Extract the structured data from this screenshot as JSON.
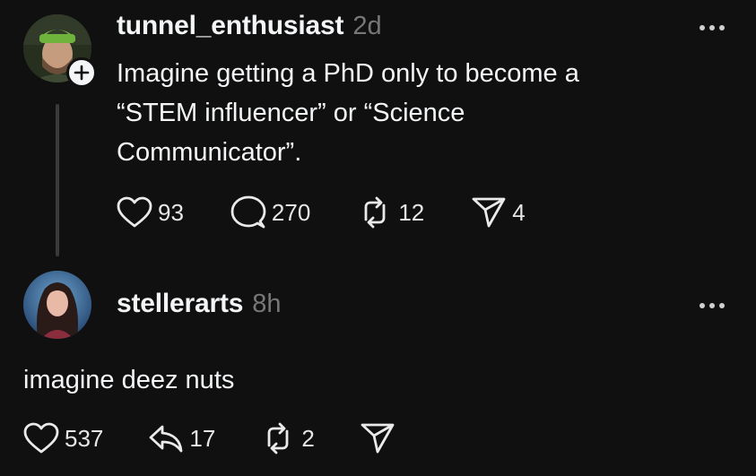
{
  "colors": {
    "background": "#101010",
    "text": "#f3f5f7",
    "muted": "#777777",
    "thread_line": "#3a3a3a"
  },
  "post": {
    "username": "tunnel_enthusiast",
    "time": "2d",
    "text_lines": [
      "Imagine getting a PhD only to become a",
      "“STEM influencer” or “Science",
      "Communicator”."
    ],
    "actions": {
      "likes": "93",
      "comments": "270",
      "reposts": "12",
      "shares": "4"
    },
    "icons": [
      "heart-icon",
      "comment-icon",
      "repost-icon",
      "share-icon",
      "plus-icon",
      "more-icon"
    ]
  },
  "reply": {
    "username": "stellerarts",
    "time": "8h",
    "text": "imagine deez nuts",
    "actions": {
      "likes": "537",
      "quotes": "17",
      "reposts": "2"
    },
    "icons": [
      "heart-icon",
      "quote-icon",
      "repost-icon",
      "share-icon",
      "more-icon"
    ]
  }
}
